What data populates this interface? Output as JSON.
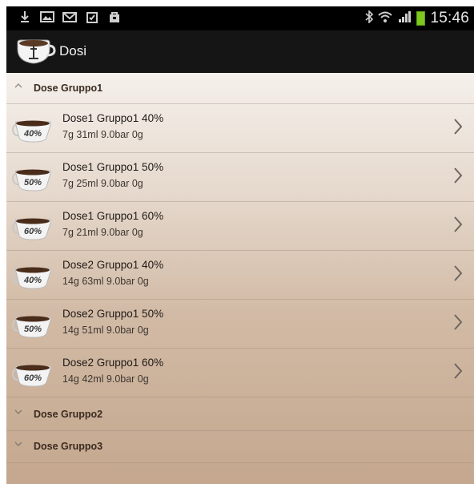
{
  "status_bar": {
    "time": "15:46",
    "left_icons": [
      "download-icon",
      "image-icon",
      "mail-icon",
      "clipboard-check-icon",
      "shopping-bag-icon"
    ],
    "right_icons": [
      "bluetooth-icon",
      "wifi-icon",
      "signal-icon",
      "battery-icon"
    ]
  },
  "action_bar": {
    "title": "Dosi",
    "icon": "coffee-cup-icon"
  },
  "groups": [
    {
      "label": "Dose Gruppo1",
      "expanded": true,
      "items": [
        {
          "title": "Dose1 Gruppo1 40%",
          "subtitle": "7g  31ml  9.0bar  0g",
          "cup_label": "40%"
        },
        {
          "title": "Dose1 Gruppo1 50%",
          "subtitle": "7g  25ml  9.0bar  0g",
          "cup_label": "50%"
        },
        {
          "title": "Dose1 Gruppo1 60%",
          "subtitle": "7g  21ml  9.0bar  0g",
          "cup_label": "60%"
        },
        {
          "title": "Dose2 Gruppo1 40%",
          "subtitle": "14g  63ml  9.0bar  0g",
          "cup_label": "40%"
        },
        {
          "title": "Dose2 Gruppo1 50%",
          "subtitle": "14g  51ml  9.0bar  0g",
          "cup_label": "50%"
        },
        {
          "title": "Dose2 Gruppo1 60%",
          "subtitle": "14g  42ml  9.0bar  0g",
          "cup_label": "60%"
        }
      ]
    },
    {
      "label": "Dose Gruppo2",
      "expanded": false
    },
    {
      "label": "Dose Gruppo3",
      "expanded": false
    }
  ],
  "colors": {
    "status_bar": "#000000",
    "action_bar": "#151515",
    "battery": "#7dc71f",
    "gradient_top": "#fbfaf9",
    "gradient_bottom": "#c4a78e"
  }
}
